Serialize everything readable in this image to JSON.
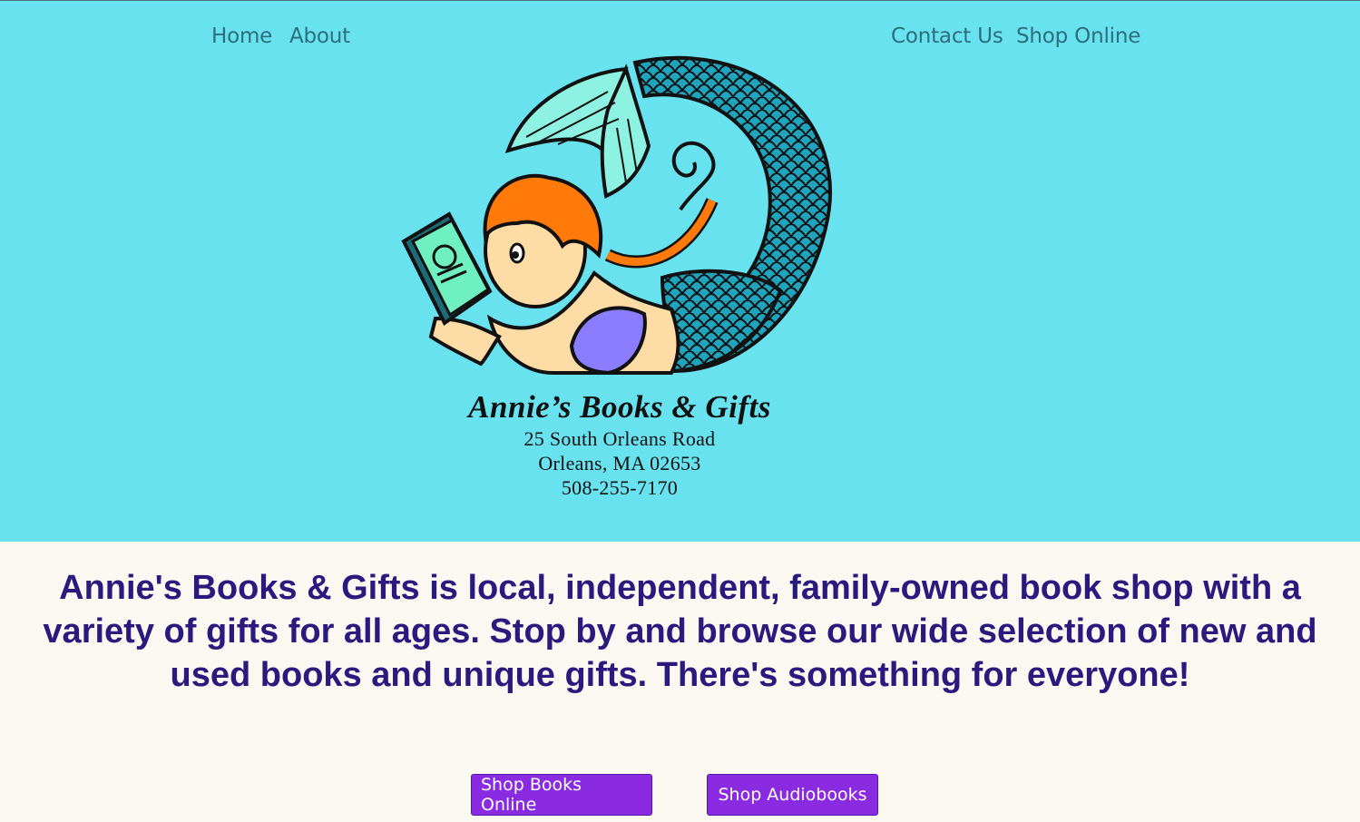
{
  "nav": {
    "home": "Home",
    "about": "About",
    "contact": "Contact Us",
    "shop_online": "Shop Online"
  },
  "logo": {
    "name": "Annie’s Books & Gifts",
    "address_line1": "25 South Orleans Road",
    "address_line2": "Orleans, MA 02653",
    "phone": "508-255-7170"
  },
  "intro": {
    "text": "Annie's Books & Gifts is local, independent, family-owned book shop with a variety of gifts for all ages. Stop by and browse our wide selection of new and used books and unique gifts. There's something for everyone!"
  },
  "buttons": {
    "shop_books": "Shop Books Online",
    "shop_audiobooks": "Shop Audiobooks"
  },
  "colors": {
    "hero_bg": "#67e2ee",
    "page_bg": "#fbf8f2",
    "nav_text": "#2d6e7e",
    "tagline_text": "#2a1a7e",
    "button_bg": "#8a2be2"
  }
}
